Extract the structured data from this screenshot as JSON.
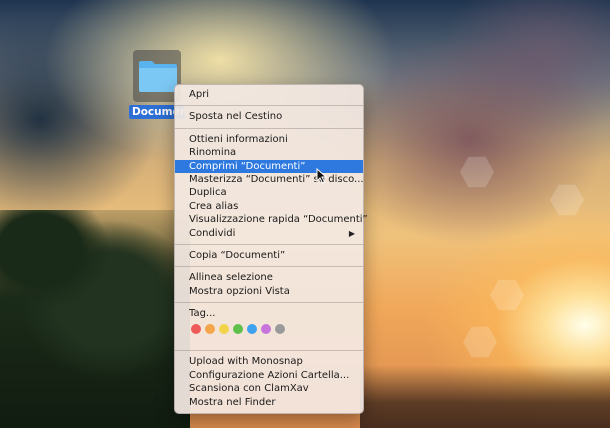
{
  "desktop": {
    "folder_name": "Documenti"
  },
  "context_menu": {
    "group1": [
      "Apri"
    ],
    "group2": [
      "Sposta nel Cestino"
    ],
    "group3": [
      "Ottieni informazioni",
      "Rinomina",
      "Comprimi “Documenti”",
      "Masterizza “Documenti” su disco...",
      "Duplica",
      "Crea alias",
      "Visualizzazione rapida “Documenti”",
      "Condividi"
    ],
    "group4": [
      "Copia “Documenti”"
    ],
    "group5": [
      "Allinea selezione",
      "Mostra opzioni Vista"
    ],
    "tags_label": "Tag...",
    "tag_colors": [
      "#ee5a57",
      "#f5a54a",
      "#f3d34a",
      "#5ec04a",
      "#3fa2ef",
      "#c774dc",
      "#9a9a9a"
    ],
    "group6": [
      "Upload with Monosnap",
      "Configurazione Azioni Cartella...",
      "Scansiona con ClamXav",
      "Mostra nel Finder"
    ],
    "highlighted": "Comprimi “Documenti”",
    "submenu_arrow": "▶"
  }
}
